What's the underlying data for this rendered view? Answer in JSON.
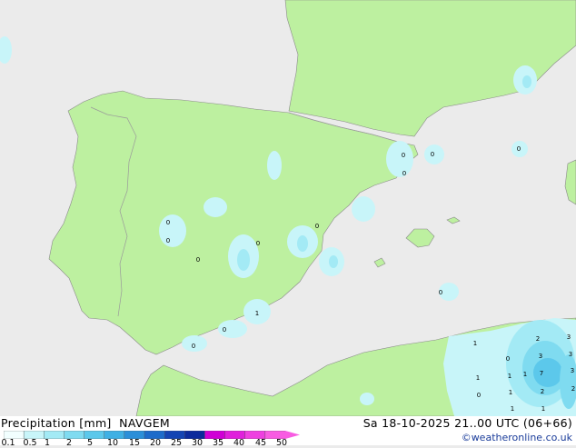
{
  "title": {
    "main": "Precipitation [mm]",
    "model": "NAVGEM",
    "datetime": "Sa 18-10-2025 21..00 UTC (06+66)",
    "credit": "©weatheronline.co.uk"
  },
  "legend": {
    "ticks": [
      "0.1",
      "0.5",
      "1",
      "2",
      "5",
      "10",
      "15",
      "20",
      "25",
      "30",
      "35",
      "40",
      "45",
      "50"
    ],
    "colors": [
      "#f2ffff",
      "#c8f5f9",
      "#a3eaf5",
      "#7fdbf0",
      "#5cc8eb",
      "#3fb0e4",
      "#2b8fd9",
      "#1d6bca",
      "#1444b3",
      "#0c2a9c",
      "#d000d6",
      "#e020dc",
      "#ee40e0",
      "#f85ce2"
    ]
  },
  "map": {
    "land_color": "#bdf0a0",
    "sea_color": "#ebebeb",
    "border_color": "#9a9a9a"
  },
  "precip_labels": [
    {
      "v": "0"
    },
    {
      "v": "0"
    },
    {
      "v": "0"
    },
    {
      "v": "0"
    },
    {
      "v": "0"
    },
    {
      "v": "0"
    },
    {
      "v": "0"
    },
    {
      "v": "0"
    },
    {
      "v": "0"
    },
    {
      "v": "0"
    },
    {
      "v": "1"
    },
    {
      "v": "0"
    },
    {
      "v": "0"
    },
    {
      "v": "1"
    },
    {
      "v": "0"
    },
    {
      "v": "1"
    },
    {
      "v": "1"
    },
    {
      "v": "0"
    },
    {
      "v": "1"
    },
    {
      "v": "2"
    },
    {
      "v": "3"
    },
    {
      "v": "3"
    },
    {
      "v": "7"
    },
    {
      "v": "3"
    },
    {
      "v": "1"
    },
    {
      "v": "1"
    },
    {
      "v": "2"
    },
    {
      "v": "2"
    },
    {
      "v": "1"
    },
    {
      "v": "3"
    }
  ]
}
